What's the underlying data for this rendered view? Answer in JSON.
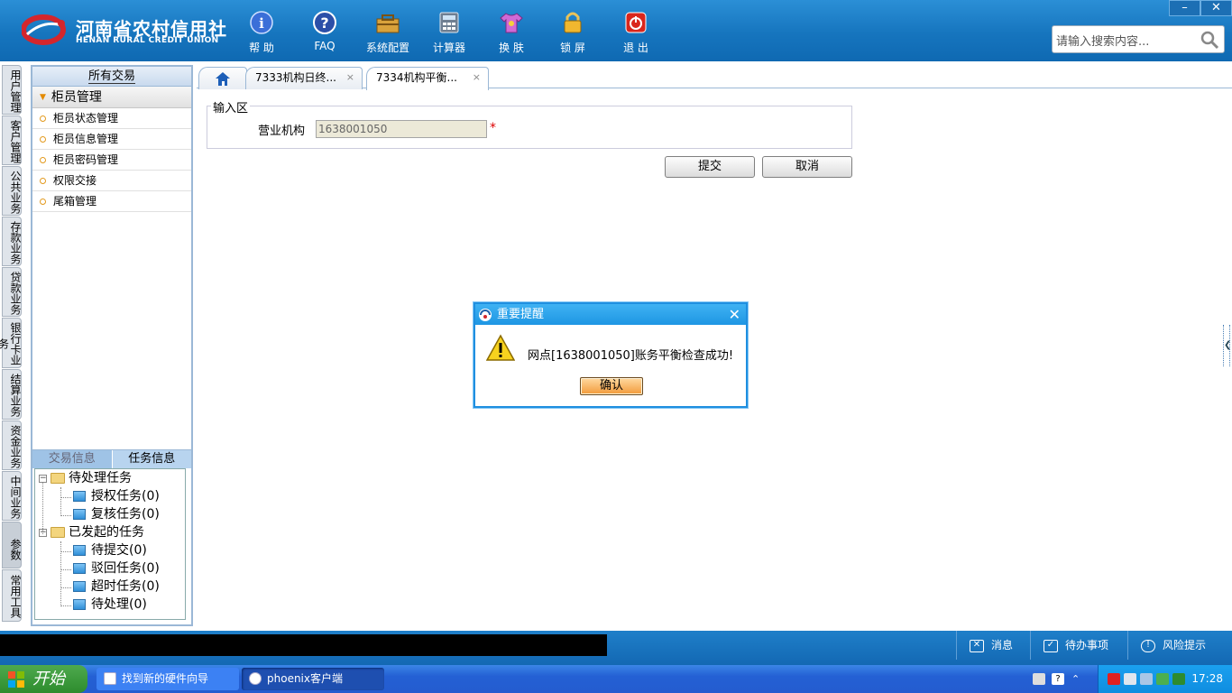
{
  "header": {
    "logo_cn": "河南省农村信用社",
    "logo_en": "HENAN RURAL CREDIT UNION",
    "toolbar": [
      {
        "label": "帮 助",
        "icon": "info-icon"
      },
      {
        "label": "FAQ",
        "icon": "question-icon"
      },
      {
        "label": "系统配置",
        "icon": "toolbox-icon"
      },
      {
        "label": "计算器",
        "icon": "calculator-icon"
      },
      {
        "label": "换 肤",
        "icon": "shirt-icon"
      },
      {
        "label": "锁 屏",
        "icon": "lock-icon"
      },
      {
        "label": "退 出",
        "icon": "power-icon"
      }
    ],
    "window_controls": [
      "–",
      "✕"
    ],
    "search_placeholder": "请输入搜索内容..."
  },
  "vertical_tabs": [
    "用户管理",
    "客户管理",
    "公共业务",
    "存款业务",
    "贷款业务",
    "银行卡业务",
    "结算业务",
    "资金业务",
    "中间业务",
    "参数",
    "常用工具"
  ],
  "left_panel": {
    "header": "所有交易",
    "group": "柜员管理",
    "items": [
      "柜员状态管理",
      "柜员信息管理",
      "柜员密码管理",
      "权限交接",
      "尾箱管理"
    ],
    "bottom_tabs": [
      "交易信息",
      "任务信息"
    ],
    "tree": {
      "pending": {
        "label": "待处理任务",
        "children": [
          "授权任务(0)",
          "复核任务(0)"
        ]
      },
      "initiated": {
        "label": "已发起的任务",
        "children": [
          "待提交(0)",
          "驳回任务(0)",
          "超时任务(0)",
          "待处理(0)"
        ]
      }
    }
  },
  "tabs": [
    {
      "label": "",
      "icon": "home-icon"
    },
    {
      "label": "7333机构日终...",
      "close": "×"
    },
    {
      "label": "7334机构平衡...",
      "close": "×"
    }
  ],
  "form": {
    "legend": "输入区",
    "field_label": "营业机构",
    "field_value": "1638001050",
    "required_mark": "*",
    "submit": "提交",
    "cancel": "取消"
  },
  "dialog": {
    "title": "重要提醒",
    "message": "网点[1638001050]账务平衡检查成功!",
    "ok": "确认",
    "close": "✕"
  },
  "statusbar": {
    "items": [
      {
        "label": "消息",
        "icon": "mail-icon"
      },
      {
        "label": "待办事项",
        "icon": "checkbox-icon"
      },
      {
        "label": "风险提示",
        "icon": "speech-icon"
      }
    ]
  },
  "taskbar": {
    "start": "开始",
    "tasks": [
      "找到新的硬件向导",
      "phoenix客户端"
    ],
    "clock": "17:28"
  }
}
